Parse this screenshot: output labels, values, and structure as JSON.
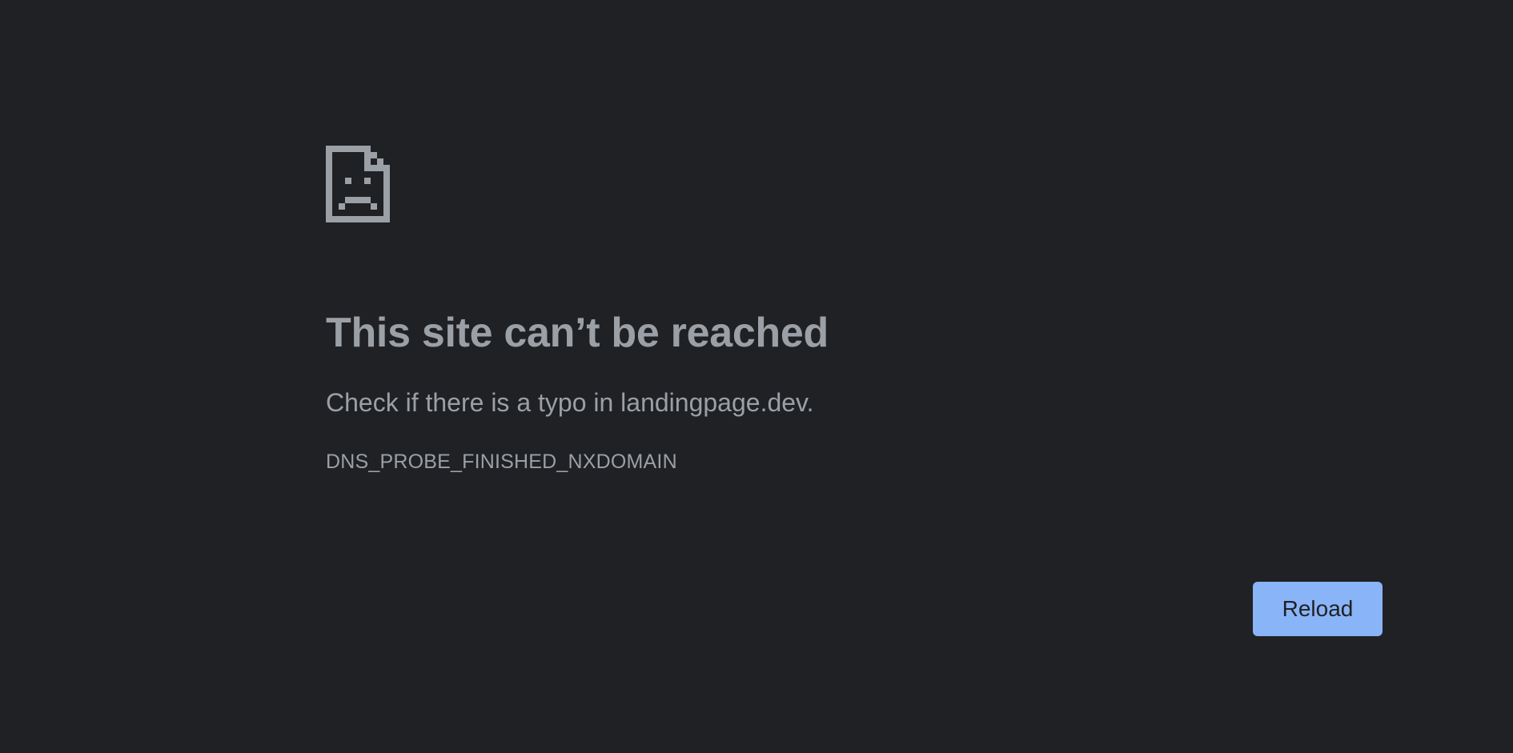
{
  "error": {
    "icon": "sad-document-icon",
    "heading": "This site can’t be reached",
    "suggestion": "Check if there is a typo in landingpage.dev.",
    "code": "DNS_PROBE_FINISHED_NXDOMAIN"
  },
  "actions": {
    "reload_label": "Reload"
  },
  "colors": {
    "background": "#202124",
    "text": "#9aa0a6",
    "button": "#8ab4f8",
    "button_text": "#202124"
  }
}
